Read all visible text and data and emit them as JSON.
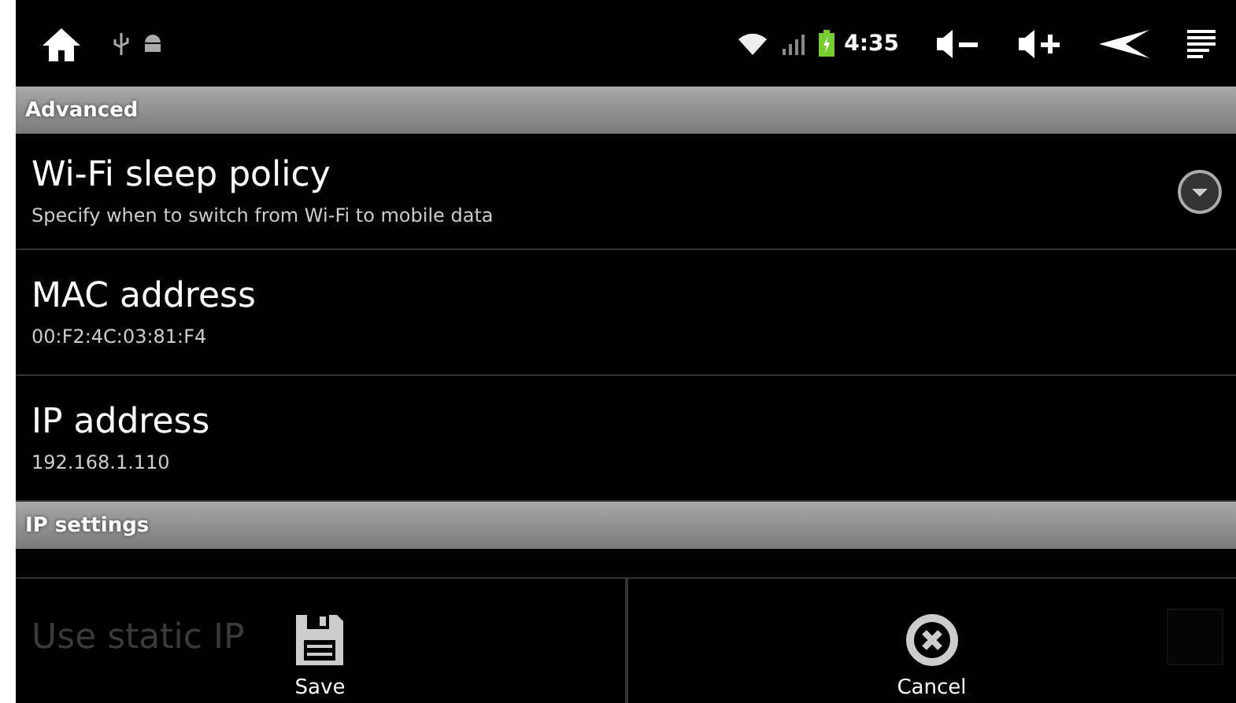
{
  "status_bar": {
    "time": "4:35"
  },
  "sections": [
    {
      "title": "Advanced",
      "items": [
        {
          "kind": "dropdown",
          "title": "Wi-Fi sleep policy",
          "summary": "Specify when to switch from Wi-Fi to mobile data"
        },
        {
          "kind": "info",
          "title": "MAC address",
          "summary": "00:F2:4C:03:81:F4"
        },
        {
          "kind": "info",
          "title": "IP address",
          "summary": "192.168.1.110"
        }
      ]
    },
    {
      "title": "IP settings",
      "items": [
        {
          "kind": "checkbox",
          "title": "Use static IP",
          "checked": false
        }
      ]
    }
  ],
  "menu": [
    {
      "kind": "save",
      "label": "Save"
    },
    {
      "kind": "cancel",
      "label": "Cancel"
    }
  ]
}
